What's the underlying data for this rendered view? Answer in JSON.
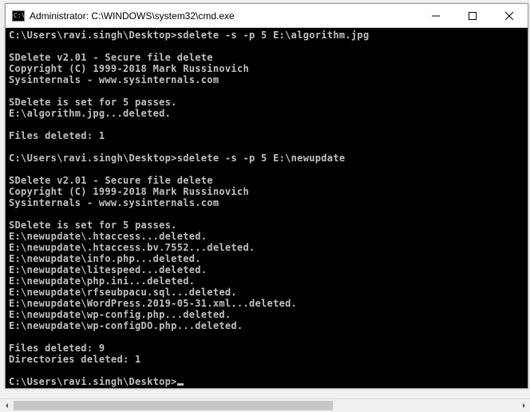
{
  "window": {
    "title": "Administrator: C:\\WINDOWS\\system32\\cmd.exe",
    "icon_glyph": "C:\\"
  },
  "terminal": {
    "lines": [
      "C:\\Users\\ravi.singh\\Desktop>sdelete -s -p 5 E:\\algorithm.jpg",
      "",
      "SDelete v2.01 - Secure file delete",
      "Copyright (C) 1999-2018 Mark Russinovich",
      "Sysinternals - www.sysinternals.com",
      "",
      "SDelete is set for 5 passes.",
      "E:\\algorithm.jpg...deleted.",
      "",
      "Files deleted: 1",
      "",
      "C:\\Users\\ravi.singh\\Desktop>sdelete -s -p 5 E:\\newupdate",
      "",
      "SDelete v2.01 - Secure file delete",
      "Copyright (C) 1999-2018 Mark Russinovich",
      "Sysinternals - www.sysinternals.com",
      "",
      "SDelete is set for 5 passes.",
      "E:\\newupdate\\.htaccess...deleted.",
      "E:\\newupdate\\.htaccess.bv.7552...deleted.",
      "E:\\newupdate\\info.php...deleted.",
      "E:\\newupdate\\litespeed...deleted.",
      "E:\\newupdate\\php.ini...deleted.",
      "E:\\newupdate\\rfseubpacu.sql...deleted.",
      "E:\\newupdate\\WordPress.2019-05-31.xml...deleted.",
      "E:\\newupdate\\wp-config.php...deleted.",
      "E:\\newupdate\\wp-configDO.php...deleted.",
      "",
      "Files deleted: 9",
      "Directories deleted: 1",
      "",
      "C:\\Users\\ravi.singh\\Desktop>"
    ]
  }
}
